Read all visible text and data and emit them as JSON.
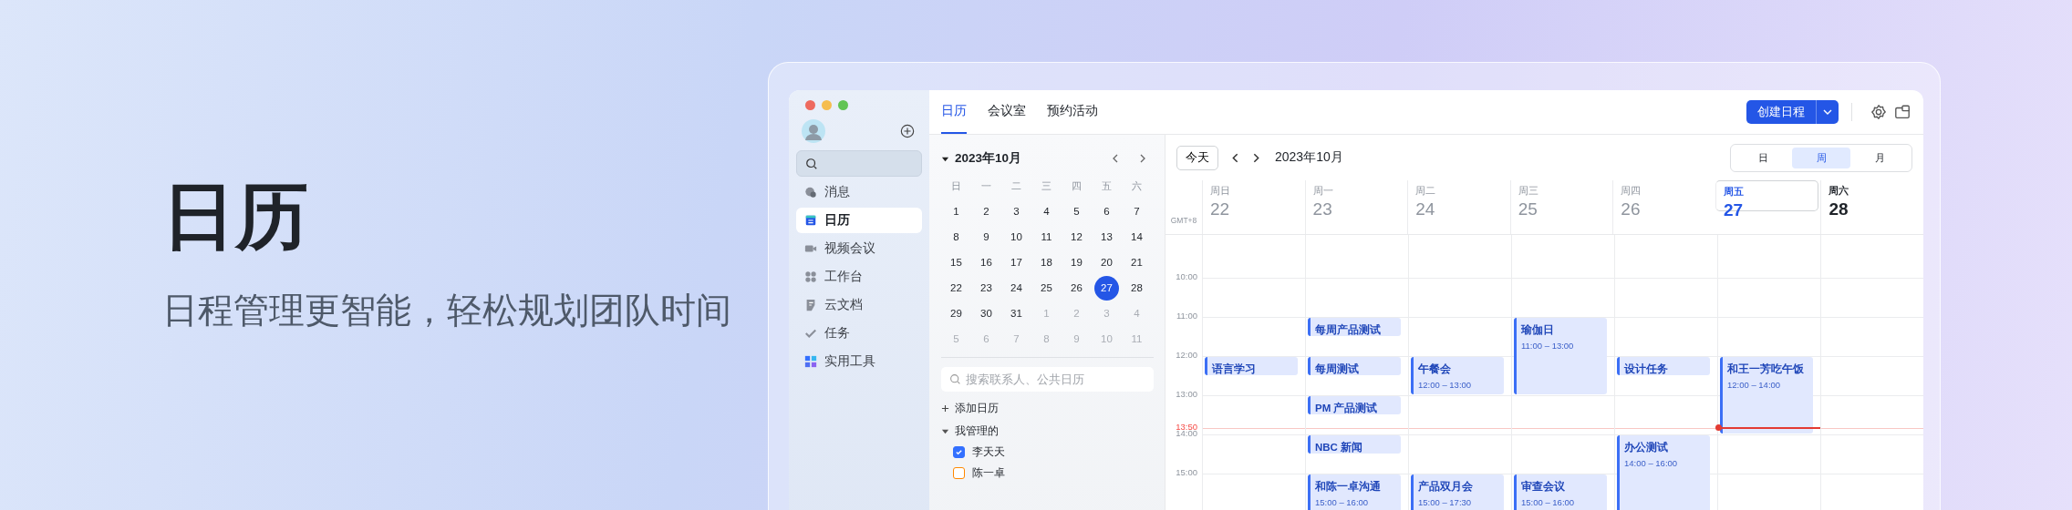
{
  "hero": {
    "title": "日历",
    "subtitle": "日程管理更智能，轻松规划团队时间"
  },
  "sidebar": {
    "items": [
      {
        "label": "消息",
        "selected": false
      },
      {
        "label": "日历",
        "selected": true
      },
      {
        "label": "视频会议",
        "selected": false
      },
      {
        "label": "工作台",
        "selected": false
      },
      {
        "label": "云文档",
        "selected": false
      },
      {
        "label": "任务",
        "selected": false
      },
      {
        "label": "实用工具",
        "selected": false
      }
    ]
  },
  "tabs": [
    {
      "label": "日历",
      "selected": true
    },
    {
      "label": "会议室",
      "selected": false
    },
    {
      "label": "预约活动",
      "selected": false
    }
  ],
  "create_button": "创建日程",
  "mini_calendar": {
    "month": "2023年10月",
    "weekdays": [
      "日",
      "一",
      "二",
      "三",
      "四",
      "五",
      "六"
    ],
    "weeks": [
      [
        {
          "day": "1",
          "in_month": true,
          "selected": false
        },
        {
          "day": "2",
          "in_month": true,
          "selected": false
        },
        {
          "day": "3",
          "in_month": true,
          "selected": false
        },
        {
          "day": "4",
          "in_month": true,
          "selected": false
        },
        {
          "day": "5",
          "in_month": true,
          "selected": false
        },
        {
          "day": "6",
          "in_month": true,
          "selected": false
        },
        {
          "day": "7",
          "in_month": true,
          "selected": false
        }
      ],
      [
        {
          "day": "8",
          "in_month": true,
          "selected": false
        },
        {
          "day": "9",
          "in_month": true,
          "selected": false
        },
        {
          "day": "10",
          "in_month": true,
          "selected": false
        },
        {
          "day": "11",
          "in_month": true,
          "selected": false
        },
        {
          "day": "12",
          "in_month": true,
          "selected": false
        },
        {
          "day": "13",
          "in_month": true,
          "selected": false
        },
        {
          "day": "14",
          "in_month": true,
          "selected": false
        }
      ],
      [
        {
          "day": "15",
          "in_month": true,
          "selected": false
        },
        {
          "day": "16",
          "in_month": true,
          "selected": false
        },
        {
          "day": "17",
          "in_month": true,
          "selected": false
        },
        {
          "day": "18",
          "in_month": true,
          "selected": false
        },
        {
          "day": "19",
          "in_month": true,
          "selected": false
        },
        {
          "day": "20",
          "in_month": true,
          "selected": false
        },
        {
          "day": "21",
          "in_month": true,
          "selected": false
        }
      ],
      [
        {
          "day": "22",
          "in_month": true,
          "selected": false
        },
        {
          "day": "23",
          "in_month": true,
          "selected": false
        },
        {
          "day": "24",
          "in_month": true,
          "selected": false
        },
        {
          "day": "25",
          "in_month": true,
          "selected": false
        },
        {
          "day": "26",
          "in_month": true,
          "selected": false
        },
        {
          "day": "27",
          "in_month": true,
          "selected": true
        },
        {
          "day": "28",
          "in_month": true,
          "selected": false
        }
      ],
      [
        {
          "day": "29",
          "in_month": true,
          "selected": false
        },
        {
          "day": "30",
          "in_month": true,
          "selected": false
        },
        {
          "day": "31",
          "in_month": true,
          "selected": false
        },
        {
          "day": "1",
          "in_month": false,
          "selected": false
        },
        {
          "day": "2",
          "in_month": false,
          "selected": false
        },
        {
          "day": "3",
          "in_month": false,
          "selected": false
        },
        {
          "day": "4",
          "in_month": false,
          "selected": false
        }
      ],
      [
        {
          "day": "5",
          "in_month": false,
          "selected": false
        },
        {
          "day": "6",
          "in_month": false,
          "selected": false
        },
        {
          "day": "7",
          "in_month": false,
          "selected": false
        },
        {
          "day": "8",
          "in_month": false,
          "selected": false
        },
        {
          "day": "9",
          "in_month": false,
          "selected": false
        },
        {
          "day": "10",
          "in_month": false,
          "selected": false
        },
        {
          "day": "11",
          "in_month": false,
          "selected": false
        }
      ]
    ]
  },
  "contact_search": {
    "placeholder": "搜索联系人、公共日历"
  },
  "add_calendar": "添加日历",
  "managed_group": {
    "label": "我管理的",
    "expanded": true,
    "calendars": [
      {
        "name": "李天天",
        "checked": true,
        "color": "#3370ff"
      },
      {
        "name": "陈一卓",
        "checked": false,
        "color": "#ff8800"
      }
    ]
  },
  "toolbar": {
    "today": "今天",
    "month": "2023年10月",
    "views": [
      {
        "label": "日",
        "selected": false
      },
      {
        "label": "周",
        "selected": true
      },
      {
        "label": "月",
        "selected": false
      }
    ]
  },
  "timezone": "GMT+8",
  "days": [
    {
      "weekday": "周日",
      "date": "22",
      "today": false,
      "past": true,
      "events": [
        {
          "title": "语言学习"
        }
      ]
    },
    {
      "weekday": "周一",
      "date": "23",
      "today": false,
      "past": true,
      "events": [
        {
          "title": "每周产品测试"
        },
        {
          "title": "每周测试"
        },
        {
          "title": "PM 产品测试"
        },
        {
          "title": "NBC 新闻"
        },
        {
          "title": "和陈一卓沟通",
          "time": "15:00 – 16:00"
        }
      ]
    },
    {
      "weekday": "周二",
      "date": "24",
      "today": false,
      "past": true,
      "events": [
        {
          "title": "午餐会",
          "time": "12:00 – 13:00"
        },
        {
          "title": "产品双月会",
          "time": "15:00 – 17:30"
        }
      ]
    },
    {
      "weekday": "周三",
      "date": "25",
      "today": false,
      "past": true,
      "events": [
        {
          "title": "瑜伽日",
          "time": "11:00 – 13:00"
        },
        {
          "title": "审查会议",
          "time": "15:00 – 16:00"
        }
      ]
    },
    {
      "weekday": "周四",
      "date": "26",
      "today": false,
      "past": true,
      "events": [
        {
          "title": "设计任务"
        },
        {
          "title": "办公测试",
          "time": "14:00 – 16:00"
        }
      ]
    },
    {
      "weekday": "周五",
      "date": "27",
      "today": true,
      "past": false,
      "events": [
        {
          "title": "和王一芳吃午饭",
          "time": "12:00 – 14:00"
        }
      ]
    },
    {
      "weekday": "周六",
      "date": "28",
      "today": false,
      "past": false
    }
  ],
  "hours": [
    "10:00",
    "11:00",
    "12:00",
    "13:00",
    "14:00",
    "15:00"
  ],
  "now": "13:50"
}
